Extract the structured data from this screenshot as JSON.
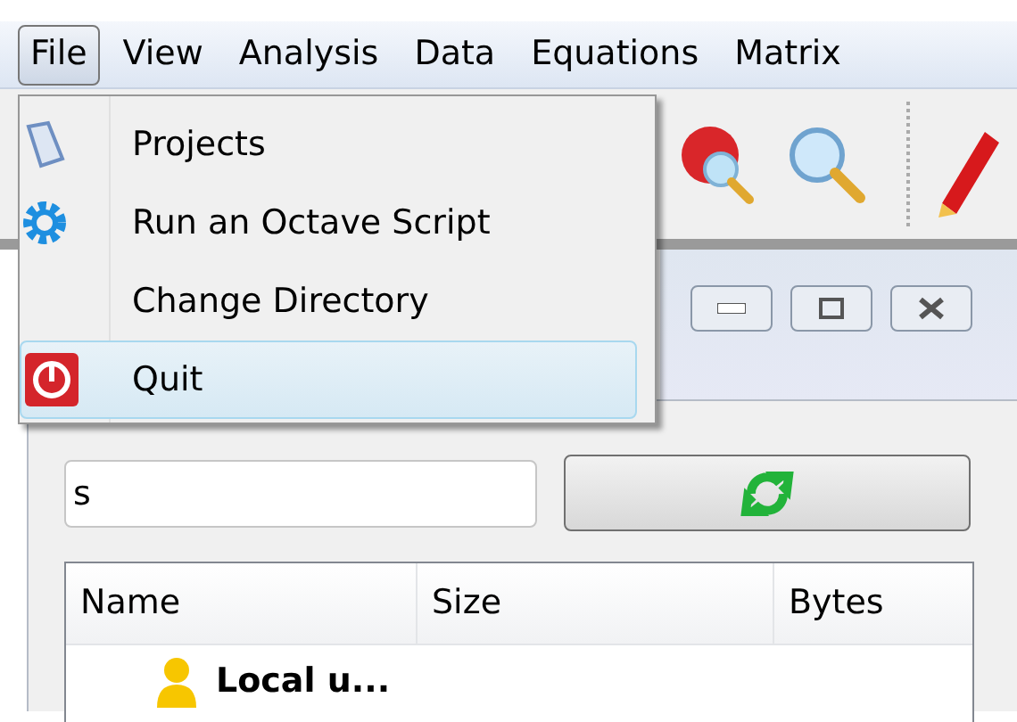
{
  "menu_bar": [
    {
      "label": "File",
      "selected": true
    },
    {
      "label": "View",
      "selected": false
    },
    {
      "label": "Analysis",
      "selected": false
    },
    {
      "label": "Data",
      "selected": false
    },
    {
      "label": "Equations",
      "selected": false
    },
    {
      "label": "Matrix",
      "selected": false
    }
  ],
  "file_menu": [
    {
      "label": "Projects",
      "kind": "book",
      "selected": false
    },
    {
      "label": "Run an Octave Script",
      "kind": "gear",
      "selected": false
    },
    {
      "label": "Change Directory",
      "kind": "none",
      "selected": false
    },
    {
      "label": "Quit",
      "kind": "power",
      "selected": true
    }
  ],
  "search_field": {
    "value": "s"
  },
  "table": {
    "columns": [
      "Name",
      "Size",
      "Bytes"
    ],
    "rows": [
      {
        "name": "Local u..."
      }
    ]
  }
}
